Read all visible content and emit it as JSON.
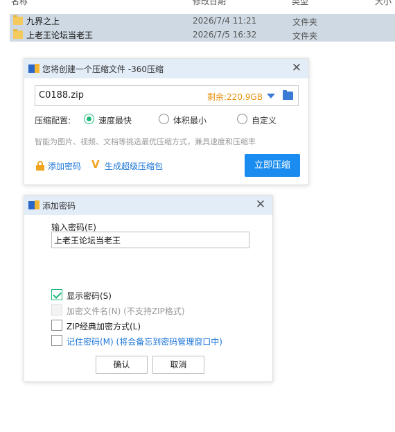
{
  "explorer": {
    "columns": {
      "name": "名称",
      "date": "修改日期",
      "type": "类型",
      "size": "大小"
    },
    "rows": [
      {
        "name": "九界之上",
        "date": "2026/7/4 11:21",
        "type": "文件夹"
      },
      {
        "name": "上老王论坛当老王",
        "date": "2026/7/5 16:32",
        "type": "文件夹"
      }
    ]
  },
  "compress_dialog": {
    "title": "您将创建一个压缩文件 -360压缩",
    "filename": "C0188.zip",
    "free_space": "剩余:220.9GB",
    "config_label": "压缩配置:",
    "options": [
      "速度最快",
      "体积最小",
      "自定义"
    ],
    "selected_option": "速度最快",
    "hint": "智能为图片、视频、文档等挑选最优压缩方式，兼具速度和压缩率",
    "add_password": "添加密码",
    "super_archive": "生成超级压缩包",
    "compress_button": "立即压缩"
  },
  "password_dialog": {
    "title": "添加密码",
    "input_label": "输入密码(E)",
    "password_value": "上老王论坛当老王",
    "checkboxes": [
      {
        "label": "显示密码(S)",
        "checked": true,
        "enabled": true
      },
      {
        "label": "加密文件名(N) (不支持ZIP格式)",
        "checked": false,
        "enabled": false
      },
      {
        "label": "ZIP经典加密方式(L)",
        "checked": false,
        "enabled": true
      },
      {
        "label": "记住密码(M) (将会备忘到密码管理窗口中)",
        "checked": false,
        "enabled": true
      }
    ],
    "ok_button": "确认",
    "cancel_button": "取消"
  },
  "colors": {
    "accent": "#1a8cf0",
    "radio_on": "#1fb87a",
    "warning": "#e8920f",
    "titlebar": "#e3edf8"
  }
}
